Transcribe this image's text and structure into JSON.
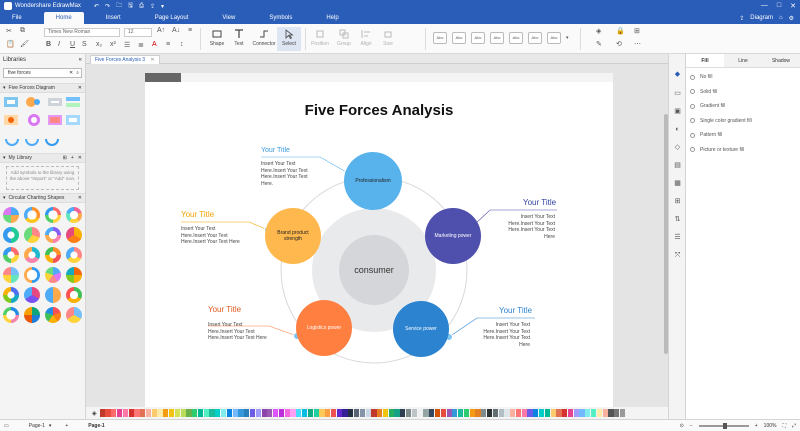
{
  "app": {
    "title": "Wondershare EdrawMax",
    "window_controls": [
      "—",
      "□",
      "✕"
    ],
    "title_icons": [
      "↶",
      "↷",
      "🗀",
      "🖫",
      "⎙",
      "⇪",
      "▾"
    ]
  },
  "menu": {
    "items": [
      "File",
      "Home",
      "Insert",
      "Page Layout",
      "View",
      "Symbols",
      "Help"
    ],
    "active": "Home",
    "diagram_label": "Diagram",
    "right_icons": [
      "⇪",
      "⌂",
      "⚙"
    ]
  },
  "toolbar": {
    "font_name": "Times New Roman",
    "font_size": "12",
    "buttons": [
      {
        "label": "Shape",
        "icon": "rectangle-icon",
        "state": "normal"
      },
      {
        "label": "Text",
        "icon": "text-icon",
        "state": "normal"
      },
      {
        "label": "Connector",
        "icon": "connector-icon",
        "state": "normal"
      },
      {
        "label": "Select",
        "icon": "cursor-icon",
        "state": "selected"
      },
      {
        "label": "Position",
        "icon": "position-icon",
        "state": "disabled"
      },
      {
        "label": "Group",
        "icon": "group-icon",
        "state": "disabled"
      },
      {
        "label": "Align",
        "icon": "align-icon",
        "state": "disabled"
      },
      {
        "label": "Size",
        "icon": "size-icon",
        "state": "disabled"
      }
    ],
    "style_swatches": [
      "Abc",
      "Abc",
      "Abc",
      "Abc",
      "Abc",
      "Abc",
      "Abc"
    ]
  },
  "libraries": {
    "header": "Libraries",
    "search_value": "five forces",
    "sections": [
      {
        "title": "Five Forces Diagram"
      },
      {
        "title": "My Library",
        "empty_text": "Add symbols to the library using the above \"Import\" or \"Add\" icon."
      },
      {
        "title": "Circular Charting Shapes"
      }
    ]
  },
  "document": {
    "tab_label": "Five Forces Analysis 3"
  },
  "diagram": {
    "title": "Five Forces Analysis",
    "center": "consumer",
    "forces": [
      {
        "name": "Professionalism",
        "color": "#58b2ec",
        "title": "Your Title",
        "title_color": "#3a9ad9",
        "body": [
          "Insert Your Text",
          "Here.Insert Your Text",
          "Here.Insert Your Text",
          "Here."
        ]
      },
      {
        "name": "Marketing power",
        "color": "#4f4fae",
        "title": "Your Title",
        "title_color": "#2f3f9a",
        "body": [
          "Insert Your Text",
          "Here.Insert Your Text",
          "Here.Insert Your Text",
          "Here"
        ]
      },
      {
        "name": "Service power",
        "color": "#2c83cf",
        "title": "Your Title",
        "title_color": "#2c83cf",
        "body": [
          "Insert Your Text",
          "Here.Insert Your Text",
          "Here.Insert Your Text",
          "Here"
        ]
      },
      {
        "name": "Logistics power",
        "color": "#ff7f41",
        "title": "Your Title",
        "title_color": "#e05a1d",
        "body": [
          "Insert Your Text",
          "Here.Insert Your Text",
          "Here.Insert Your Text Here"
        ]
      },
      {
        "name": "Brand product strength",
        "color": "#ffb84d",
        "title": "Your Title",
        "title_color": "#f0a400",
        "body": [
          "Insert Your Text",
          "Here.Insert Your Text",
          "Here.Insert Your Text Here"
        ]
      }
    ]
  },
  "fill_panel": {
    "tabs": [
      "Fill",
      "Line",
      "Shadow"
    ],
    "active_tab": "Fill",
    "options": [
      "No fill",
      "Solid fill",
      "Gradient fill",
      "Single color gradient fill",
      "Pattern fill",
      "Picture or texture fill"
    ]
  },
  "status": {
    "page_selector": "Page-1",
    "page_tab": "Page-1",
    "zoom": "100%"
  },
  "palette_colors": [
    "#c0392b",
    "#e74c3c",
    "#ff6b6b",
    "#e84393",
    "#fd79a8",
    "#d63031",
    "#ff7675",
    "#e17055",
    "#fab1a0",
    "#fdcb6e",
    "#ffeaa7",
    "#f39c12",
    "#f1c40f",
    "#d4e157",
    "#badc58",
    "#6ab04c",
    "#2ecc71",
    "#00b894",
    "#55efc4",
    "#1abc9c",
    "#00cec9",
    "#81ecec",
    "#0984e3",
    "#74b9ff",
    "#3498db",
    "#2980b9",
    "#6c5ce7",
    "#a29bfe",
    "#8e44ad",
    "#9b59b6",
    "#e056fd",
    "#be2edd",
    "#f368e0",
    "#ff9ff3",
    "#48dbfb",
    "#0abde3",
    "#10ac84",
    "#1dd1a1",
    "#feca57",
    "#ff9f43",
    "#ee5253",
    "#5f27cd",
    "#341f97",
    "#222f3e",
    "#576574",
    "#8395a7",
    "#c8d6e5",
    "#c0392b",
    "#e67e22",
    "#f1c40f",
    "#27ae60",
    "#16a085",
    "#2c3e50",
    "#7f8c8d",
    "#bdc3c7",
    "#ecf0f1",
    "#95a5a6",
    "#34495e",
    "#d35400",
    "#e74c3c",
    "#9b59b6",
    "#3498db",
    "#1abc9c",
    "#2ecc71",
    "#f39c12",
    "#e67e22",
    "#7f8c8d",
    "#2d3436",
    "#636e72",
    "#b2bec3",
    "#dfe6e9",
    "#fab1a0",
    "#ff7675",
    "#fd79a8",
    "#6c5ce7",
    "#0984e3",
    "#00cec9",
    "#00b894",
    "#fdcb6e",
    "#e17055",
    "#d63031",
    "#e84393",
    "#a29bfe",
    "#74b9ff",
    "#81ecec",
    "#55efc4",
    "#ffeaa7",
    "#fab1a0",
    "#555555",
    "#777777",
    "#999999"
  ]
}
